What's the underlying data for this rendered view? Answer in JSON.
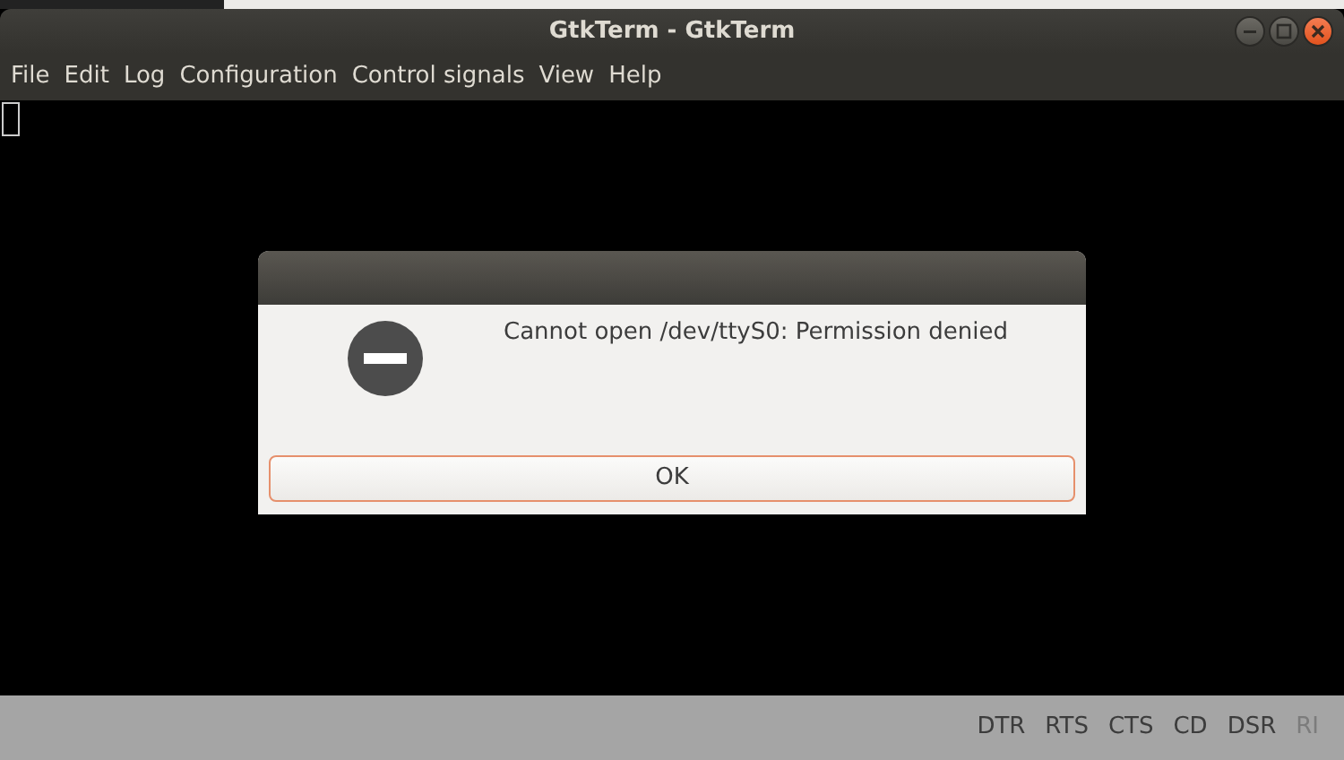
{
  "window": {
    "title": "GtkTerm - GtkTerm"
  },
  "menu": [
    "File",
    "Edit",
    "Log",
    "Configuration",
    "Control signals",
    "View",
    "Help"
  ],
  "dialog": {
    "kind": "error",
    "message": "Cannot open /dev/ttyS0: Permission denied",
    "buttons": [
      "OK"
    ]
  },
  "status_bar": {
    "signals": [
      {
        "label": "DTR",
        "on": true
      },
      {
        "label": "RTS",
        "on": true
      },
      {
        "label": "CTS",
        "on": true
      },
      {
        "label": "CD",
        "on": true
      },
      {
        "label": "DSR",
        "on": true
      },
      {
        "label": "RI",
        "on": false
      }
    ]
  }
}
